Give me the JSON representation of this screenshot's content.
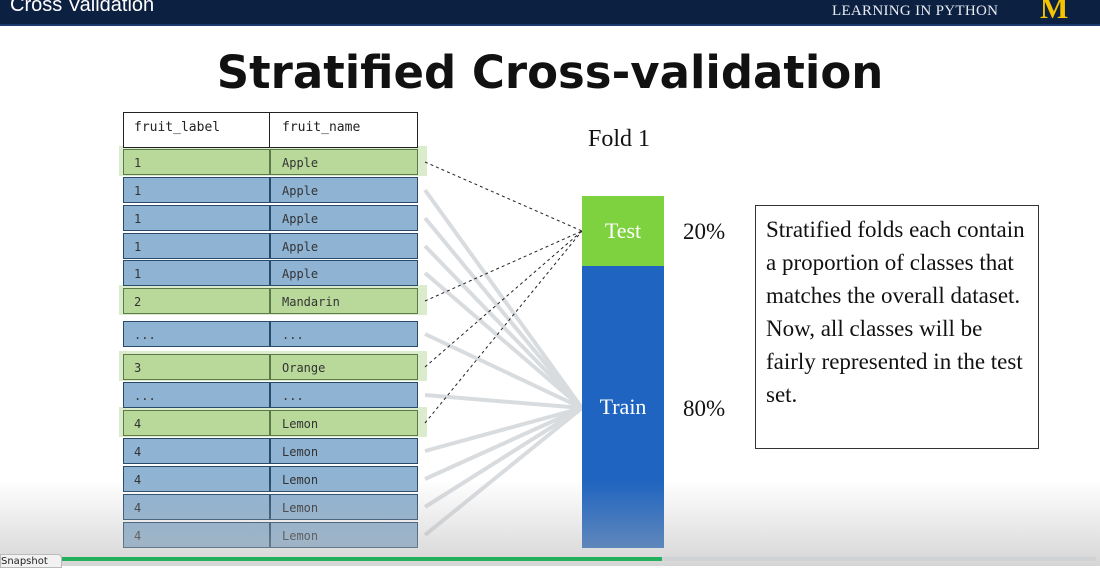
{
  "header": {
    "title": "Cross Validation",
    "brand": "LEARNING IN PYTHON",
    "logo_letter": "M"
  },
  "slide": {
    "title": "Stratified Cross-validation",
    "table": {
      "columns": [
        "fruit_label",
        "fruit_name"
      ],
      "rows": [
        {
          "label": "1",
          "name": "Apple",
          "split": "test"
        },
        {
          "label": "1",
          "name": "Apple",
          "split": "train"
        },
        {
          "label": "1",
          "name": "Apple",
          "split": "train"
        },
        {
          "label": "1",
          "name": "Apple",
          "split": "train"
        },
        {
          "label": "1",
          "name": "Apple",
          "split": "train"
        },
        {
          "label": "2",
          "name": "Mandarin",
          "split": "test"
        },
        {
          "label": "...",
          "name": "...",
          "split": "train"
        },
        {
          "label": "3",
          "name": "Orange",
          "split": "test"
        },
        {
          "label": "...",
          "name": "...",
          "split": "train"
        },
        {
          "label": "4",
          "name": "Lemon",
          "split": "test"
        },
        {
          "label": "4",
          "name": "Lemon",
          "split": "train"
        },
        {
          "label": "4",
          "name": "Lemon",
          "split": "train"
        },
        {
          "label": "4",
          "name": "Lemon",
          "split": "train"
        },
        {
          "label": "4",
          "name": "Lemon",
          "split": "train"
        }
      ]
    },
    "fold": {
      "label": "Fold 1",
      "test_label": "Test",
      "train_label": "Train",
      "test_pct": "20%",
      "train_pct": "80%",
      "test_fraction": 0.2,
      "train_fraction": 0.8
    },
    "note": "Stratified folds each contain a proportion of classes that matches the overall dataset. Now, all classes will be fairly represented in the test set.",
    "colors": {
      "test": "#7ed23f",
      "train": "#1f64c0",
      "row_test": "#b9d99a",
      "row_train": "#8fb3d3"
    }
  },
  "player": {
    "snapshot_tab": "Snapshot",
    "progress": 0.58
  }
}
